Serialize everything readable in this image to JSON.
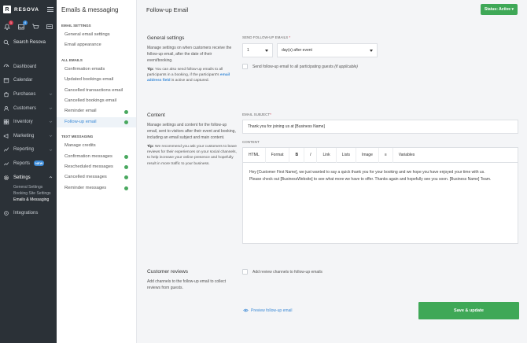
{
  "app": {
    "brand": "RESOVA",
    "search_label": "Search Resova",
    "notifications_count": "1",
    "messages_count": "4"
  },
  "colors": {
    "sidebar_bg": "#2b3137",
    "accent_blue": "#3a89d6",
    "success_green": "#3fa857",
    "danger_red": "#d0364b"
  },
  "sidebar": {
    "items": [
      {
        "label": "Dashboard",
        "icon": "dashboard-icon",
        "chevron": false
      },
      {
        "label": "Calendar",
        "icon": "calendar-icon",
        "chevron": false
      },
      {
        "label": "Purchases",
        "icon": "purchases-icon",
        "chevron": true
      },
      {
        "label": "Customers",
        "icon": "customers-icon",
        "chevron": true
      },
      {
        "label": "Inventory",
        "icon": "inventory-icon",
        "chevron": true
      },
      {
        "label": "Marketing",
        "icon": "marketing-icon",
        "chevron": true
      },
      {
        "label": "Reporting",
        "icon": "reporting-icon",
        "chevron": true
      },
      {
        "label": "Reports",
        "icon": "reports-icon",
        "badge": "NEW",
        "chevron": false
      },
      {
        "label": "Settings",
        "icon": "gear-icon",
        "chevron": true,
        "active": true
      }
    ],
    "settings_sub": [
      "General Settings",
      "Booking Site Settings",
      "Emails & Messaging"
    ],
    "integrations": "Integrations"
  },
  "menu2": {
    "title": "Emails & messaging",
    "section_email_settings": "EMAIL SETTINGS",
    "email_settings": [
      "General email settings",
      "Email appearance"
    ],
    "section_all_emails": "ALL EMAILS",
    "all_emails": [
      {
        "label": "Confirmation emails",
        "enabled": false
      },
      {
        "label": "Updated bookings email",
        "enabled": false
      },
      {
        "label": "Cancelled transactions email",
        "enabled": false
      },
      {
        "label": "Cancelled bookings email",
        "enabled": false
      },
      {
        "label": "Reminder email",
        "enabled": true
      },
      {
        "label": "Follow-up email",
        "enabled": true,
        "active": true
      }
    ],
    "section_text": "TEXT MESSAGING",
    "text_messaging": [
      {
        "label": "Manage credits",
        "enabled": false
      },
      {
        "label": "Confirmation messages",
        "enabled": true
      },
      {
        "label": "Rescheduled messages",
        "enabled": true
      },
      {
        "label": "Cancelled messages",
        "enabled": true
      },
      {
        "label": "Reminder messages",
        "enabled": true
      }
    ]
  },
  "main": {
    "title": "Follow-up Email",
    "status_button": "Status: Active",
    "general": {
      "title": "General settings",
      "desc": "Manage settings on when customers receive the follow-up email, after the date of their event/booking.",
      "tip_label": "Tip:",
      "tip_text": " You can also send follow-up emails to all participants in a booking, if the participant's ",
      "tip_link": "email address field",
      "tip_after": " is active and captured.",
      "send_label": "SEND FOLLOW-UP EMAILS",
      "req_mark": "*",
      "days_value": "1",
      "when_value": "day(s) after event",
      "all_guests_label": "Send follow-up email to all participating guests ",
      "all_guests_hint": "(if applicable)"
    },
    "content": {
      "title": "Content",
      "desc": "Manage settings and content for the follow-up email, sent to visitors after their event and booking, including an email subject and main content.",
      "tip_label": "Tip:",
      "tip_text": " We recommend you ask your customers to leave reviews for their experiences on your social channels, to help increase your online presence and hopefully result in more traffic to your business.",
      "subject_label": "EMAIL SUBJECT",
      "subject_value": "Thank you for joining us at [Business Name]",
      "content_label": "CONTENT",
      "toolbar": [
        "HTML",
        "Format",
        "B",
        "I",
        "Link",
        "Lists",
        "Image",
        "≡",
        "Variables"
      ],
      "body_line1": "Hey [Customer First Name], we just wanted to say a quick thank you for your booking and we hope you have enjoyed your time with us.",
      "body_line2": "Please check out [BusinessWebsite] to see what more we have to offer. Thanks again and hopefully see you soon. [Business Name] Team."
    },
    "reviews": {
      "title": "Customer reviews",
      "desc": "Add channels to the follow-up email to collect reviews from guests.",
      "checkbox_label": "Add review channels to follow-up emails"
    },
    "preview_link": "Preview follow-up email",
    "save_button": "Save & update"
  }
}
